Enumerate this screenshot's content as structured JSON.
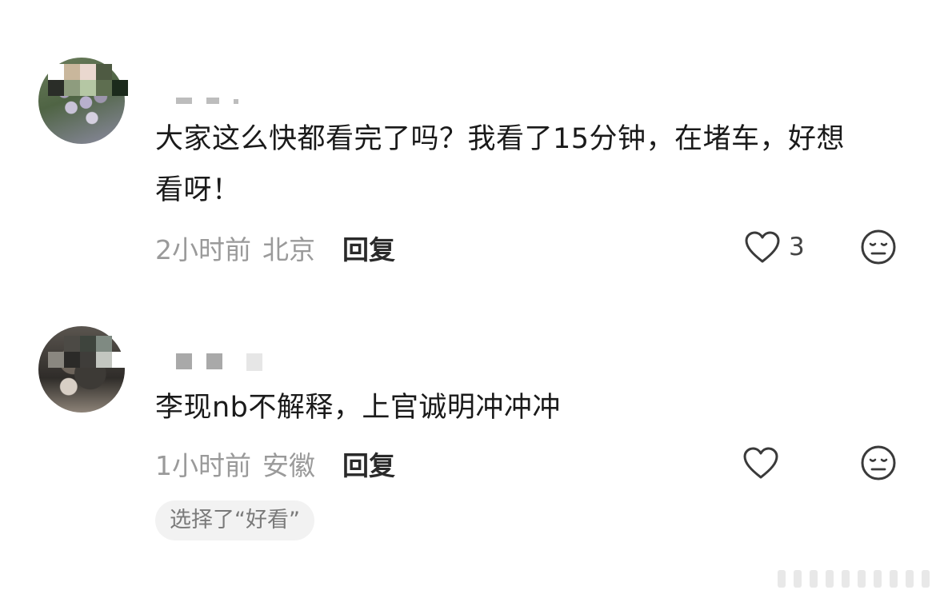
{
  "comments": [
    {
      "text": "大家这么快都看完了吗？我看了15分钟，在堵车，好想看呀！",
      "time": "2小时前",
      "location": "北京",
      "reply_label": "回复",
      "like_count": "3"
    },
    {
      "text": "李现nb不解释，上官诚明冲冲冲",
      "time": "1小时前",
      "location": "安徽",
      "reply_label": "回复",
      "like_count": "",
      "tag": "选择了“好看”"
    }
  ],
  "colors": {
    "meta_text": "#9a9a9a",
    "reply_text": "#2a2a2a",
    "tag_bg": "#f2f2f2"
  },
  "icons": {
    "like": "heart-outline-icon",
    "reaction": "neutral-face-icon"
  }
}
